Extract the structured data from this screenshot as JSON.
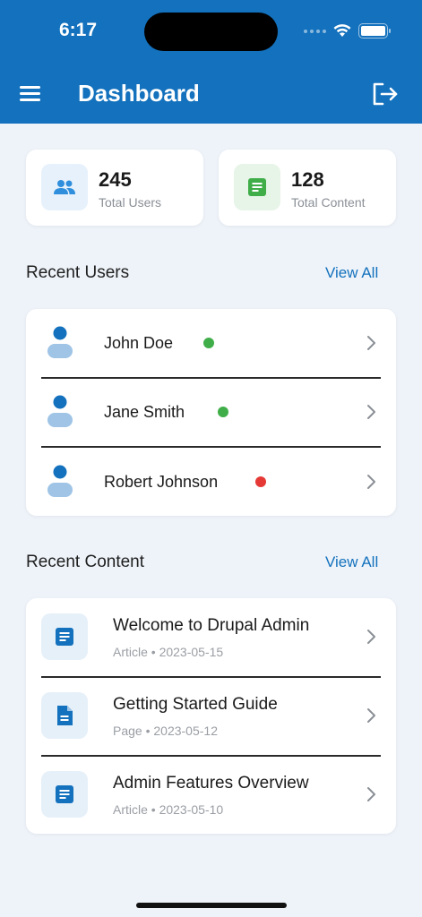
{
  "status_bar": {
    "time": "6:17"
  },
  "header": {
    "title": "Dashboard"
  },
  "stats": [
    {
      "value": "245",
      "label": "Total Users",
      "icon": "people-icon",
      "icon_color": "#2f8fdc",
      "icon_bg": "#e6f1fb"
    },
    {
      "value": "128",
      "label": "Total Content",
      "icon": "document-icon",
      "icon_color": "#3fae49",
      "icon_bg": "#e7f4e8"
    }
  ],
  "recent_users": {
    "title": "Recent Users",
    "view_all": "View All",
    "items": [
      {
        "name": "John Doe",
        "status": "active",
        "status_color": "#3fae49"
      },
      {
        "name": "Jane Smith",
        "status": "active",
        "status_color": "#3fae49"
      },
      {
        "name": "Robert Johnson",
        "status": "inactive",
        "status_color": "#e53935"
      }
    ]
  },
  "recent_content": {
    "title": "Recent Content",
    "view_all": "View All",
    "items": [
      {
        "title": "Welcome to Drupal Admin",
        "meta": "Article • 2023-05-15",
        "icon": "article-icon"
      },
      {
        "title": "Getting Started Guide",
        "meta": "Page • 2023-05-12",
        "icon": "page-icon"
      },
      {
        "title": "Admin Features Overview",
        "meta": "Article • 2023-05-10",
        "icon": "article-icon"
      }
    ]
  },
  "colors": {
    "primary": "#1371bd",
    "background": "#eef3f9"
  }
}
